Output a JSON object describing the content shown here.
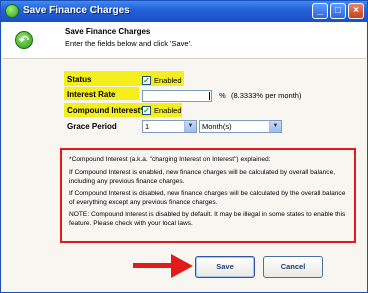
{
  "window": {
    "title": "Save Finance Charges"
  },
  "header": {
    "title": "Save Finance Charges",
    "subtitle": "Enter the fields below and click 'Save'."
  },
  "form": {
    "status": {
      "label": "Status",
      "checkbox_label": "Enabled",
      "checked": true
    },
    "interest_rate": {
      "label": "Interest Rate",
      "value": "",
      "unit": "%",
      "per_month": "(8.3333% per month)"
    },
    "compound_interest": {
      "label": "Compound Interest*",
      "checkbox_label": "Enabled",
      "checked": true
    },
    "grace_period": {
      "label": "Grace Period",
      "amount": "1",
      "unit": "Month(s)"
    }
  },
  "notes": {
    "heading": "*Compound Interest (a.k.a. \"charging Interest on Interest\") explained:",
    "enabled": "If Compound Interest is enabled, new finance charges will be calculated by overall balance, including any previous finance charges.",
    "disabled": "If Compound Interest is disabled, new finance charges will be calculated by the overall balance of everything except any previous finance charges.",
    "note": "NOTE: Compound Interest is disabled by default. It may be illegal in some states to enable this feature. Please check with your local laws."
  },
  "buttons": {
    "save": "Save",
    "cancel": "Cancel"
  },
  "colors": {
    "highlight": "#f4ef1c",
    "callout_border": "#e31a1a",
    "arrow": "#e31a1a",
    "titlebar": "#2462d8"
  }
}
